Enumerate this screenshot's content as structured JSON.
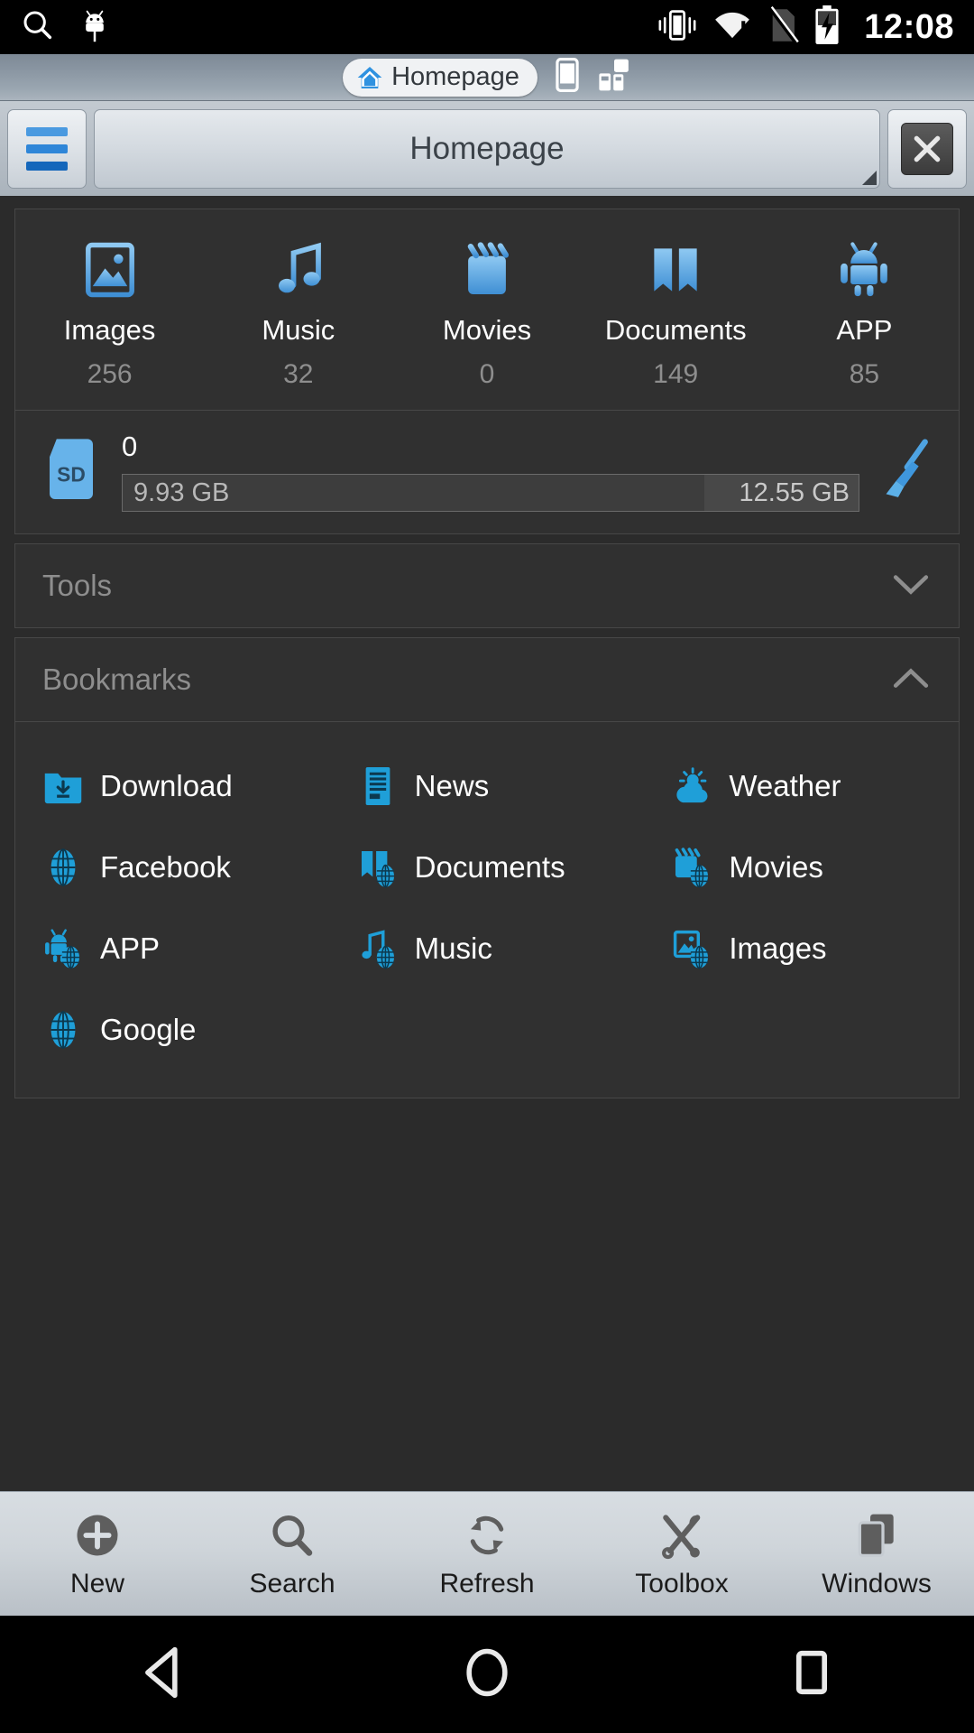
{
  "statusbar": {
    "time": "12:08",
    "icons": [
      "search-icon",
      "android-usb-icon",
      "vibrate-icon",
      "wifi-warning-icon",
      "no-sim-icon",
      "battery-charging-icon"
    ]
  },
  "tabstrip": {
    "active_tab": "Homepage",
    "tabs": [
      "Homepage"
    ],
    "extra_icons": [
      "phone-icon",
      "lan-devices-icon"
    ]
  },
  "addressbar": {
    "menu_icon": "hamburger-menu-icon",
    "path": "Homepage",
    "close_icon": "close-icon"
  },
  "categories": [
    {
      "label": "Images",
      "count": "256",
      "icon": "image-icon"
    },
    {
      "label": "Music",
      "count": "32",
      "icon": "music-note-icon"
    },
    {
      "label": "Movies",
      "count": "0",
      "icon": "clapperboard-icon"
    },
    {
      "label": "Documents",
      "count": "149",
      "icon": "open-book-icon"
    },
    {
      "label": "APP",
      "count": "85",
      "icon": "android-icon"
    }
  ],
  "storage": {
    "icon": "sd-card-icon",
    "name": "0",
    "free": "9.93 GB",
    "total": "12.55 GB",
    "used_percent": 21,
    "clean_icon": "broom-icon"
  },
  "sections": [
    {
      "title": "Tools",
      "expanded": false,
      "chevron": "chevron-down-icon"
    },
    {
      "title": "Bookmarks",
      "expanded": true,
      "chevron": "chevron-up-icon"
    }
  ],
  "bookmarks": [
    [
      {
        "label": "Download",
        "icon": "folder-download-icon"
      },
      {
        "label": "News",
        "icon": "news-document-icon"
      },
      {
        "label": "Weather",
        "icon": "weather-cloud-sun-icon"
      }
    ],
    [
      {
        "label": "Facebook",
        "icon": "globe-icon"
      },
      {
        "label": "Documents",
        "icon": "book-globe-icon"
      },
      {
        "label": "Movies",
        "icon": "clapper-globe-icon"
      }
    ],
    [
      {
        "label": "APP",
        "icon": "android-globe-icon"
      },
      {
        "label": "Music",
        "icon": "music-globe-icon"
      },
      {
        "label": "Images",
        "icon": "image-globe-icon"
      }
    ],
    [
      {
        "label": "Google",
        "icon": "globe-icon"
      }
    ]
  ],
  "toolbar": [
    {
      "label": "New",
      "icon": "plus-circle-icon"
    },
    {
      "label": "Search",
      "icon": "search-icon"
    },
    {
      "label": "Refresh",
      "icon": "refresh-icon"
    },
    {
      "label": "Toolbox",
      "icon": "toolbox-wrench-icon"
    },
    {
      "label": "Windows",
      "icon": "windows-stack-icon"
    }
  ],
  "navbar": [
    {
      "name": "back-button",
      "icon": "triangle-back-icon"
    },
    {
      "name": "home-button",
      "icon": "circle-home-icon"
    },
    {
      "name": "recents-button",
      "icon": "square-recents-icon"
    }
  ],
  "colors": {
    "accent_blue": "#5ba8e8",
    "bookmark_blue": "#1f9fd8",
    "background": "#2b2b2b",
    "panel": "#303030"
  }
}
